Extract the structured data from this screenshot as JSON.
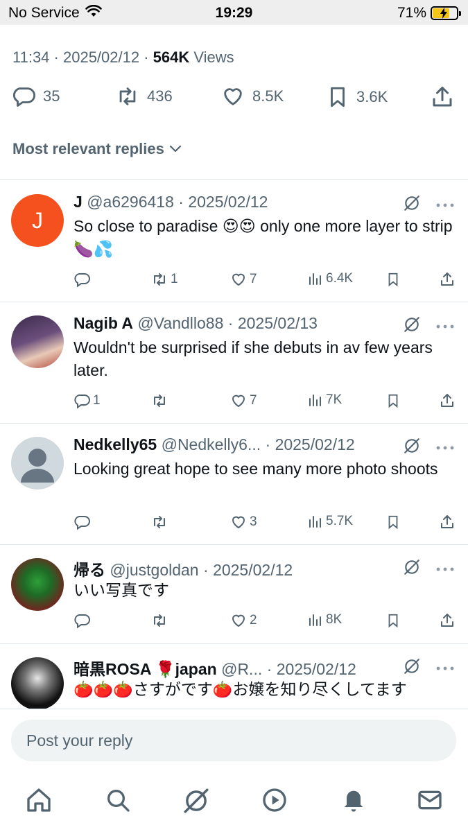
{
  "status_bar": {
    "carrier": "No Service",
    "time": "19:29",
    "battery": "71%",
    "battery_level": 0.71
  },
  "post_meta": {
    "time": "11:34",
    "date": "2025/02/12",
    "views_count": "564K",
    "views_label": "Views"
  },
  "stats": {
    "replies": "35",
    "reposts": "436",
    "likes": "8.5K",
    "bookmarks": "3.6K"
  },
  "sort_label": "Most relevant replies",
  "replies": [
    {
      "name": "J",
      "handle": "@a6296418",
      "date": "2025/02/12",
      "text": "So close to paradise 😍😍 only one more layer to strip 🍆💦",
      "replies": "",
      "reposts": "1",
      "likes": "7",
      "views": "6.4K",
      "avatar_letter": "J",
      "avatar_color": "#f4511e"
    },
    {
      "name": "Nagib A",
      "handle": "@Vandllo88",
      "date": "2025/02/13",
      "text": "Wouldn't be surprised if she debuts in av few years later.",
      "replies": "1",
      "reposts": "",
      "likes": "7",
      "views": "7K"
    },
    {
      "name": "Nedkelly65",
      "handle": "@Nedkelly6...",
      "date": "2025/02/12",
      "text": "Looking great hope to see many more photo shoots",
      "replies": "",
      "reposts": "",
      "likes": "3",
      "views": "5.7K"
    },
    {
      "name": "帰る",
      "handle": "@justgoldan",
      "date": "2025/02/12",
      "text": "いい写真です",
      "replies": "",
      "reposts": "",
      "likes": "2",
      "views": "8K"
    },
    {
      "name": "暗黒ROSA 🌹japan",
      "handle": "@R...",
      "date": "2025/02/12",
      "text": "🍅🍅🍅さすがです🍅お嬢を知り尽くしてます"
    }
  ],
  "compose_placeholder": "Post your reply",
  "colors": {
    "secondary_text": "#536471",
    "primary_text": "#0f1419",
    "divider": "#e1e6ea",
    "compose_bg": "#eff3f4"
  }
}
